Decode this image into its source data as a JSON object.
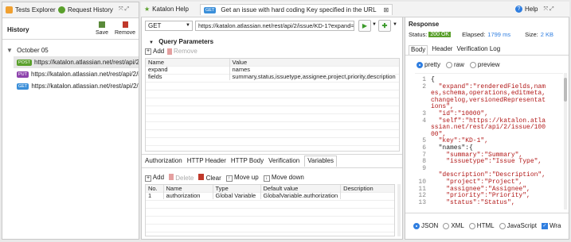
{
  "left_tabs": {
    "tests_explorer": "Tests Explorer",
    "request_history": "Request History"
  },
  "history": {
    "title": "History",
    "save": "Save",
    "remove": "Remove",
    "group": "October 05",
    "items": [
      {
        "method": "POST",
        "color": "#5aa02c",
        "url": "https://katalon.atlassian.net/rest/api/2/i"
      },
      {
        "method": "PUT",
        "color": "#8e44ad",
        "url": "https://katalon.atlassian.net/rest/api/2/i"
      },
      {
        "method": "GET",
        "color": "#3b8fd9",
        "url": "https://katalon.atlassian.net/rest/api/2/i"
      }
    ]
  },
  "editor_tabs": {
    "help": "Katalon Help",
    "badge": "GET",
    "active": "Get an issue with hard coding Key specified in the URL"
  },
  "request": {
    "method": "GET",
    "url": "https://katalon.atlassian.net/rest/api/2/issue/KD-1?expand="
  },
  "query": {
    "title": "Query Parameters",
    "add": "Add",
    "remove": "Remove",
    "headers": [
      "Name",
      "Value"
    ],
    "rows": [
      [
        "expand",
        "names"
      ],
      [
        "fields",
        "summary,status,issuetype,assignee,project,priority,description"
      ]
    ]
  },
  "bottom_tabs": [
    "Authorization",
    "HTTP Header",
    "HTTP Body",
    "Verification",
    "Variables"
  ],
  "variables": {
    "add": "Add",
    "delete": "Delete",
    "clear": "Clear",
    "move_up": "Move up",
    "move_down": "Move down",
    "headers": [
      "No.",
      "Name",
      "Type",
      "Default value",
      "Description"
    ],
    "rows": [
      [
        "1",
        "authorization",
        "Global Variable",
        "GlobalVariable.authorization",
        ""
      ]
    ]
  },
  "topright": {
    "help": "Help"
  },
  "response": {
    "title": "Response",
    "status_label": "Status:",
    "status": "200 OK",
    "elapsed_label": "Elapsed:",
    "elapsed": "1799 ms",
    "size_label": "Size:",
    "size": "2 KB",
    "tabs": [
      "Body",
      "Header",
      "Verification Log"
    ],
    "modes": [
      "pretty",
      "raw",
      "preview"
    ],
    "formats": [
      "JSON",
      "XML",
      "HTML",
      "JavaScript",
      "Wra"
    ],
    "accent": "#2f7ee0",
    "ok_color": "#5aa02c"
  },
  "json_lines": [
    {
      "n": "1",
      "t": "{"
    },
    {
      "n": "2",
      "t": "  \"expand\":\"renderedFields,nam"
    },
    {
      "n": "",
      "t": "es,schema,operations,editmeta,"
    },
    {
      "n": "",
      "t": "changelog,versionedRepresentat"
    },
    {
      "n": "",
      "t": "ions\","
    },
    {
      "n": "3",
      "t": "  \"id\":\"10000\","
    },
    {
      "n": "4",
      "t": "  \"self\":\"https://katalon.atla"
    },
    {
      "n": "",
      "t": "ssian.net/rest/api/2/issue/100"
    },
    {
      "n": "",
      "t": "00\","
    },
    {
      "n": "5",
      "t": "  \"key\":\"KD-1\","
    },
    {
      "n": "6",
      "t": "  \"names\":{"
    },
    {
      "n": "7",
      "t": "    \"summary\":\"Summary\","
    },
    {
      "n": "8",
      "t": "    \"issuetype\":\"Issue Type\","
    },
    {
      "n": "9",
      "t": ""
    },
    {
      "n": "",
      "t": "  \"description\":\"Description\","
    },
    {
      "n": "10",
      "t": "    \"project\":\"Project\","
    },
    {
      "n": "11",
      "t": "    \"assignee\":\"Assignee\","
    },
    {
      "n": "12",
      "t": "    \"priority\":\"Priority\","
    },
    {
      "n": "13",
      "t": "    \"status\":\"Status\","
    }
  ]
}
